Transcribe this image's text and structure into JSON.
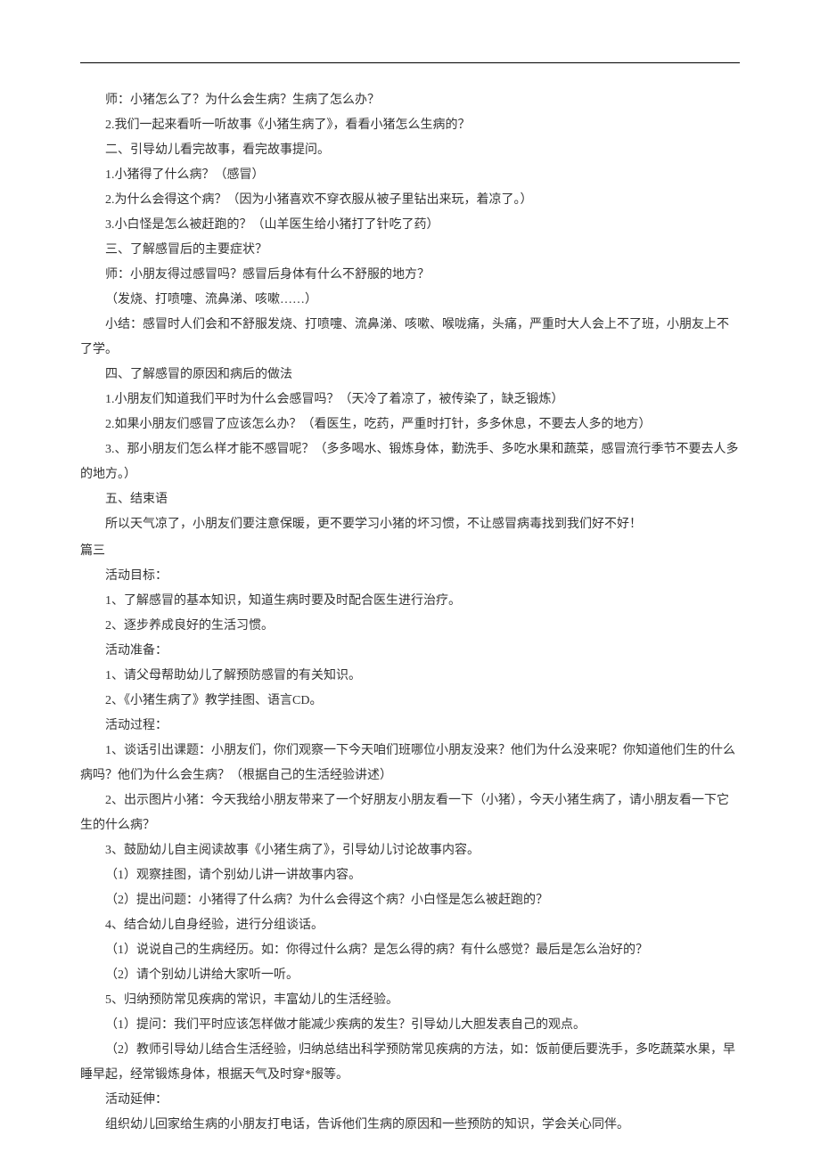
{
  "lines": [
    {
      "cls": "indent",
      "text": "师：小猪怎么了？为什么会生病？生病了怎么办？"
    },
    {
      "cls": "indent",
      "text": "2.我们一起来看听一听故事《小猪生病了》，看看小猪怎么生病的？"
    },
    {
      "cls": "indent",
      "text": "二、引导幼儿看完故事，看完故事提问。"
    },
    {
      "cls": "indent",
      "text": "1.小猪得了什么病？（感冒）"
    },
    {
      "cls": "indent",
      "text": "2.为什么会得这个病？（因为小猪喜欢不穿衣服从被子里钻出来玩，着凉了。）"
    },
    {
      "cls": "indent",
      "text": "3.小白怪是怎么被赶跑的？（山羊医生给小猪打了针吃了药）"
    },
    {
      "cls": "indent",
      "text": "三、了解感冒后的主要症状？"
    },
    {
      "cls": "indent",
      "text": "师：小朋友得过感冒吗？感冒后身体有什么不舒服的地方？"
    },
    {
      "cls": "indent",
      "text": "（发烧、打喷嚏、流鼻涕、咳嗽……）"
    },
    {
      "cls": "indent",
      "text": "小结：感冒时人们会和不舒服发烧、打喷嚏、流鼻涕、咳嗽、喉咙痛，头痛，严重时大人会上不了班，小朋友上不了学。"
    },
    {
      "cls": "indent",
      "text": "四、了解感冒的原因和病后的做法"
    },
    {
      "cls": "indent",
      "text": "1.小朋友们知道我们平时为什么会感冒吗？（天冷了着凉了，被传染了，缺乏锻炼）"
    },
    {
      "cls": "indent",
      "text": "2.如果小朋友们感冒了应该怎么办？（看医生，吃药，严重时打针，多多休息，不要去人多的地方）"
    },
    {
      "cls": "indent",
      "text": "3.、那小朋友们怎么样才能不感冒呢？（多多喝水、锻炼身体，勤洗手、多吃水果和蔬菜，感冒流行季节不要去人多的地方。）"
    },
    {
      "cls": "indent",
      "text": "五、结束语"
    },
    {
      "cls": "indent",
      "text": "所以天气凉了，小朋友们要注意保暖，更不要学习小猪的坏习惯，不让感冒病毒找到我们好不好！"
    },
    {
      "cls": "section-heading",
      "text": "篇三"
    },
    {
      "cls": "indent",
      "text": "活动目标："
    },
    {
      "cls": "indent",
      "text": "1、了解感冒的基本知识，知道生病时要及时配合医生进行治疗。"
    },
    {
      "cls": "indent",
      "text": "2、逐步养成良好的生活习惯。"
    },
    {
      "cls": "indent",
      "text": "活动准备："
    },
    {
      "cls": "indent",
      "text": "1、请父母帮助幼儿了解预防感冒的有关知识。"
    },
    {
      "cls": "indent",
      "text": "2、《小猪生病了》教学挂图、语言CD。"
    },
    {
      "cls": "indent",
      "text": "活动过程："
    },
    {
      "cls": "indent",
      "text": "1、谈话引出课题：小朋友们，你们观察一下今天咱们班哪位小朋友没来？他们为什么没来呢？你知道他们生的什么病吗？他们为什么会生病？（根据自己的生活经验讲述）"
    },
    {
      "cls": "indent",
      "text": "2、出示图片小猪：今天我给小朋友带来了一个好朋友小朋友看一下（小猪），今天小猪生病了，请小朋友看一下它生的什么病？"
    },
    {
      "cls": "indent",
      "text": "3、鼓励幼儿自主阅读故事《小猪生病了》，引导幼儿讨论故事内容。"
    },
    {
      "cls": "indent",
      "text": "（1）观察挂图，请个别幼儿讲一讲故事内容。"
    },
    {
      "cls": "indent",
      "text": "（2）提出问题：小猪得了什么病？为什么会得这个病？小白怪是怎么被赶跑的？"
    },
    {
      "cls": "indent",
      "text": "4、结合幼儿自身经验，进行分组谈话。"
    },
    {
      "cls": "indent",
      "text": "（1）说说自己的生病经历。如：你得过什么病？是怎么得的病？有什么感觉？最后是怎么治好的？"
    },
    {
      "cls": "indent",
      "text": "（2）请个别幼儿讲给大家听一听。"
    },
    {
      "cls": "indent",
      "text": "5、归纳预防常见疾病的常识，丰富幼儿的生活经验。"
    },
    {
      "cls": "indent",
      "text": "（1）提问：我们平时应该怎样做才能减少疾病的发生？引导幼儿大胆发表自己的观点。"
    },
    {
      "cls": "indent",
      "text": "（2）教师引导幼儿结合生活经验，归纳总结出科学预防常见疾病的方法，如：饭前便后要洗手，多吃蔬菜水果，早睡早起，经常锻炼身体，根据天气及时穿*服等。"
    },
    {
      "cls": "indent",
      "text": "活动延伸："
    },
    {
      "cls": "indent",
      "text": "组织幼儿回家给生病的小朋友打电话，告诉他们生病的原因和一些预防的知识，学会关心同伴。"
    }
  ]
}
